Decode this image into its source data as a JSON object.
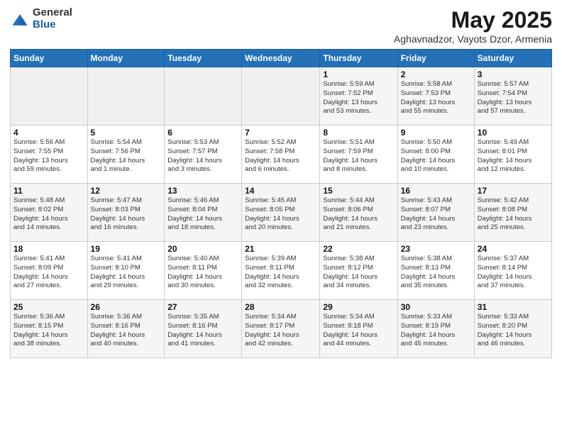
{
  "header": {
    "logo_general": "General",
    "logo_blue": "Blue",
    "main_title": "May 2025",
    "subtitle": "Aghavnadzor, Vayots Dzor, Armenia"
  },
  "days_of_week": [
    "Sunday",
    "Monday",
    "Tuesday",
    "Wednesday",
    "Thursday",
    "Friday",
    "Saturday"
  ],
  "weeks": [
    [
      {
        "day": "",
        "info": ""
      },
      {
        "day": "",
        "info": ""
      },
      {
        "day": "",
        "info": ""
      },
      {
        "day": "",
        "info": ""
      },
      {
        "day": "1",
        "info": "Sunrise: 5:59 AM\nSunset: 7:52 PM\nDaylight: 13 hours\nand 53 minutes."
      },
      {
        "day": "2",
        "info": "Sunrise: 5:58 AM\nSunset: 7:53 PM\nDaylight: 13 hours\nand 55 minutes."
      },
      {
        "day": "3",
        "info": "Sunrise: 5:57 AM\nSunset: 7:54 PM\nDaylight: 13 hours\nand 57 minutes."
      }
    ],
    [
      {
        "day": "4",
        "info": "Sunrise: 5:56 AM\nSunset: 7:55 PM\nDaylight: 13 hours\nand 59 minutes."
      },
      {
        "day": "5",
        "info": "Sunrise: 5:54 AM\nSunset: 7:56 PM\nDaylight: 14 hours\nand 1 minute."
      },
      {
        "day": "6",
        "info": "Sunrise: 5:53 AM\nSunset: 7:57 PM\nDaylight: 14 hours\nand 3 minutes."
      },
      {
        "day": "7",
        "info": "Sunrise: 5:52 AM\nSunset: 7:58 PM\nDaylight: 14 hours\nand 6 minutes."
      },
      {
        "day": "8",
        "info": "Sunrise: 5:51 AM\nSunset: 7:59 PM\nDaylight: 14 hours\nand 8 minutes."
      },
      {
        "day": "9",
        "info": "Sunrise: 5:50 AM\nSunset: 8:00 PM\nDaylight: 14 hours\nand 10 minutes."
      },
      {
        "day": "10",
        "info": "Sunrise: 5:49 AM\nSunset: 8:01 PM\nDaylight: 14 hours\nand 12 minutes."
      }
    ],
    [
      {
        "day": "11",
        "info": "Sunrise: 5:48 AM\nSunset: 8:02 PM\nDaylight: 14 hours\nand 14 minutes."
      },
      {
        "day": "12",
        "info": "Sunrise: 5:47 AM\nSunset: 8:03 PM\nDaylight: 14 hours\nand 16 minutes."
      },
      {
        "day": "13",
        "info": "Sunrise: 5:46 AM\nSunset: 8:04 PM\nDaylight: 14 hours\nand 18 minutes."
      },
      {
        "day": "14",
        "info": "Sunrise: 5:45 AM\nSunset: 8:05 PM\nDaylight: 14 hours\nand 20 minutes."
      },
      {
        "day": "15",
        "info": "Sunrise: 5:44 AM\nSunset: 8:06 PM\nDaylight: 14 hours\nand 21 minutes."
      },
      {
        "day": "16",
        "info": "Sunrise: 5:43 AM\nSunset: 8:07 PM\nDaylight: 14 hours\nand 23 minutes."
      },
      {
        "day": "17",
        "info": "Sunrise: 5:42 AM\nSunset: 8:08 PM\nDaylight: 14 hours\nand 25 minutes."
      }
    ],
    [
      {
        "day": "18",
        "info": "Sunrise: 5:41 AM\nSunset: 8:09 PM\nDaylight: 14 hours\nand 27 minutes."
      },
      {
        "day": "19",
        "info": "Sunrise: 5:41 AM\nSunset: 8:10 PM\nDaylight: 14 hours\nand 29 minutes."
      },
      {
        "day": "20",
        "info": "Sunrise: 5:40 AM\nSunset: 8:11 PM\nDaylight: 14 hours\nand 30 minutes."
      },
      {
        "day": "21",
        "info": "Sunrise: 5:39 AM\nSunset: 8:11 PM\nDaylight: 14 hours\nand 32 minutes."
      },
      {
        "day": "22",
        "info": "Sunrise: 5:38 AM\nSunset: 8:12 PM\nDaylight: 14 hours\nand 34 minutes."
      },
      {
        "day": "23",
        "info": "Sunrise: 5:38 AM\nSunset: 8:13 PM\nDaylight: 14 hours\nand 35 minutes."
      },
      {
        "day": "24",
        "info": "Sunrise: 5:37 AM\nSunset: 8:14 PM\nDaylight: 14 hours\nand 37 minutes."
      }
    ],
    [
      {
        "day": "25",
        "info": "Sunrise: 5:36 AM\nSunset: 8:15 PM\nDaylight: 14 hours\nand 38 minutes."
      },
      {
        "day": "26",
        "info": "Sunrise: 5:36 AM\nSunset: 8:16 PM\nDaylight: 14 hours\nand 40 minutes."
      },
      {
        "day": "27",
        "info": "Sunrise: 5:35 AM\nSunset: 8:16 PM\nDaylight: 14 hours\nand 41 minutes."
      },
      {
        "day": "28",
        "info": "Sunrise: 5:34 AM\nSunset: 8:17 PM\nDaylight: 14 hours\nand 42 minutes."
      },
      {
        "day": "29",
        "info": "Sunrise: 5:34 AM\nSunset: 8:18 PM\nDaylight: 14 hours\nand 44 minutes."
      },
      {
        "day": "30",
        "info": "Sunrise: 5:33 AM\nSunset: 8:19 PM\nDaylight: 14 hours\nand 45 minutes."
      },
      {
        "day": "31",
        "info": "Sunrise: 5:33 AM\nSunset: 8:20 PM\nDaylight: 14 hours\nand 46 minutes."
      }
    ]
  ]
}
